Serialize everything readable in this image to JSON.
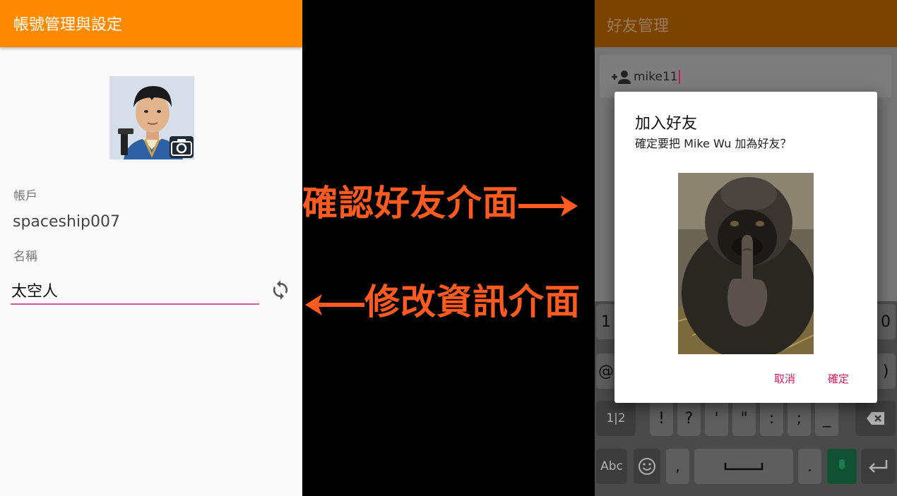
{
  "left_screen": {
    "title": "帳號管理與設定",
    "account_label": "帳戶",
    "account_value": "spaceship007",
    "name_label": "名稱",
    "name_value": "太空人",
    "appbar_color": "#ff8a00",
    "accent_color": "#e0569a"
  },
  "annotations": {
    "confirm_friend": "確認好友介面",
    "edit_info": "修改資訊介面",
    "color": "#ff5a1f"
  },
  "right_screen": {
    "title": "好友管理",
    "search_value": "mike11",
    "keyboard": {
      "row1": [
        "1",
        "0"
      ],
      "row2": [
        "@",
        ")"
      ],
      "row3": [
        "1|2",
        "!",
        "?",
        "'",
        "\"",
        ":",
        ";",
        "_"
      ],
      "row4": [
        "Abc",
        ",",
        "."
      ]
    }
  },
  "dialog": {
    "title": "加入好友",
    "message": "確定要把 Mike Wu 加為好友？",
    "cancel_label": "取消",
    "confirm_label": "確定"
  }
}
